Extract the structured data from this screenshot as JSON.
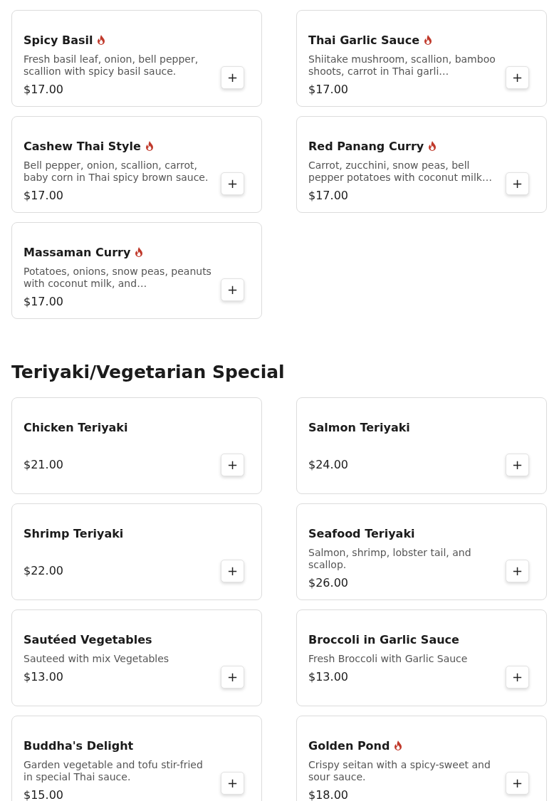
{
  "sections": [
    {
      "items": [
        {
          "name": "Spicy Basil",
          "spicy": true,
          "description": "Fresh basil leaf, onion, bell pepper, scallion with spicy basil sauce.",
          "price": "$17.00",
          "button": "+"
        },
        {
          "name": "Thai Garlic Sauce",
          "spicy": true,
          "description": "Shiitake mushroom, scallion, bamboo shoots, carrot in Thai garli…",
          "price": "$17.00",
          "button": "+"
        },
        {
          "name": "Cashew Thai Style",
          "spicy": true,
          "description": "Bell pepper, onion, scallion, carrot, baby corn in Thai spicy brown sauce.",
          "price": "$17.00",
          "button": "+"
        },
        {
          "name": "Red Panang Curry",
          "spicy": true,
          "description": "Carrot, zucchini, snow peas, bell pepper potatoes with coconut milk…",
          "price": "$17.00",
          "button": "+"
        },
        {
          "name": "Massaman Curry",
          "spicy": true,
          "description": "Potatoes, onions, snow peas, peanuts with coconut milk, and…",
          "price": "$17.00",
          "button": "+"
        }
      ]
    },
    {
      "title": "Teriyaki/Vegetarian Special",
      "items": [
        {
          "name": "Chicken Teriyaki",
          "spicy": false,
          "price": "$21.00",
          "button": "+"
        },
        {
          "name": "Salmon Teriyaki",
          "spicy": false,
          "price": "$24.00",
          "button": "+"
        },
        {
          "name": "Shrimp Teriyaki",
          "spicy": false,
          "price": "$22.00",
          "button": "+"
        },
        {
          "name": "Seafood Teriyaki",
          "spicy": false,
          "description": "Salmon, shrimp, lobster tail, and scallop.",
          "price": "$26.00",
          "button": "+"
        },
        {
          "name": "Sautéed Vegetables",
          "spicy": false,
          "description": "Sauteed with mix Vegetables",
          "price": "$13.00",
          "button": "+"
        },
        {
          "name": "Broccoli in Garlic Sauce",
          "spicy": false,
          "description": "Fresh Broccoli with Garlic Sauce",
          "price": "$13.00",
          "button": "+"
        },
        {
          "name": "Buddha's Delight",
          "spicy": false,
          "description": "Garden vegetable and tofu stir-fried in special Thai sauce.",
          "price": "$15.00",
          "button": "+"
        },
        {
          "name": "Golden Pond",
          "spicy": true,
          "description": "Crispy seitan with a spicy-sweet and sour sauce.",
          "price": "$18.00",
          "button": "+"
        }
      ]
    }
  ]
}
